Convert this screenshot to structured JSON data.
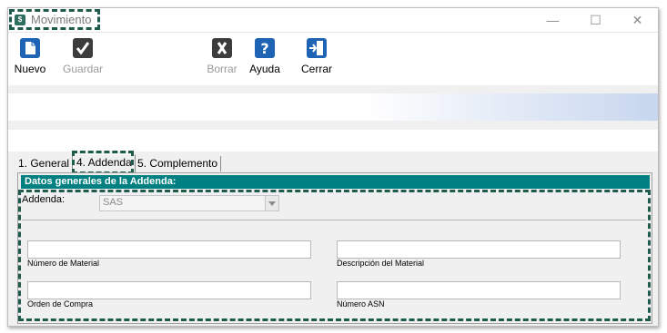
{
  "window": {
    "title": "Movimiento",
    "app_icon": "app-logo-icon",
    "controls": {
      "minimize": "—",
      "maximize": "☐",
      "close": "✕"
    }
  },
  "toolbar": {
    "buttons": [
      {
        "label": "Nuevo",
        "icon": "new-document-icon",
        "enabled": true
      },
      {
        "label": "Guardar",
        "icon": "checkmark-icon",
        "enabled": false
      },
      {
        "label": "Borrar",
        "icon": "delete-x-icon",
        "enabled": false
      },
      {
        "label": "Ayuda",
        "icon": "help-icon",
        "enabled": true
      },
      {
        "label": "Cerrar",
        "icon": "exit-door-icon",
        "enabled": true
      }
    ]
  },
  "tabs": [
    {
      "label": "1. General",
      "active": false
    },
    {
      "label": "4. Addenda",
      "active": true
    },
    {
      "label": "5. Complemento",
      "active": false
    }
  ],
  "addenda": {
    "header": "Datos generales de la Addenda:",
    "addenda_label": "Addenda:",
    "addenda_value": "SAS",
    "fields": {
      "numero_material": {
        "label": "Número de Material",
        "value": ""
      },
      "descripcion_material": {
        "label": "Descripción del Material",
        "value": ""
      },
      "orden_compra": {
        "label": "Orden de Compra",
        "value": ""
      },
      "numero_asn": {
        "label": "Número ASN",
        "value": ""
      }
    }
  },
  "colors": {
    "header_bg": "#008080",
    "highlight": "#1f5b4d",
    "icon_blue": "#1f64b4",
    "icon_dark": "#3c3c3c"
  }
}
